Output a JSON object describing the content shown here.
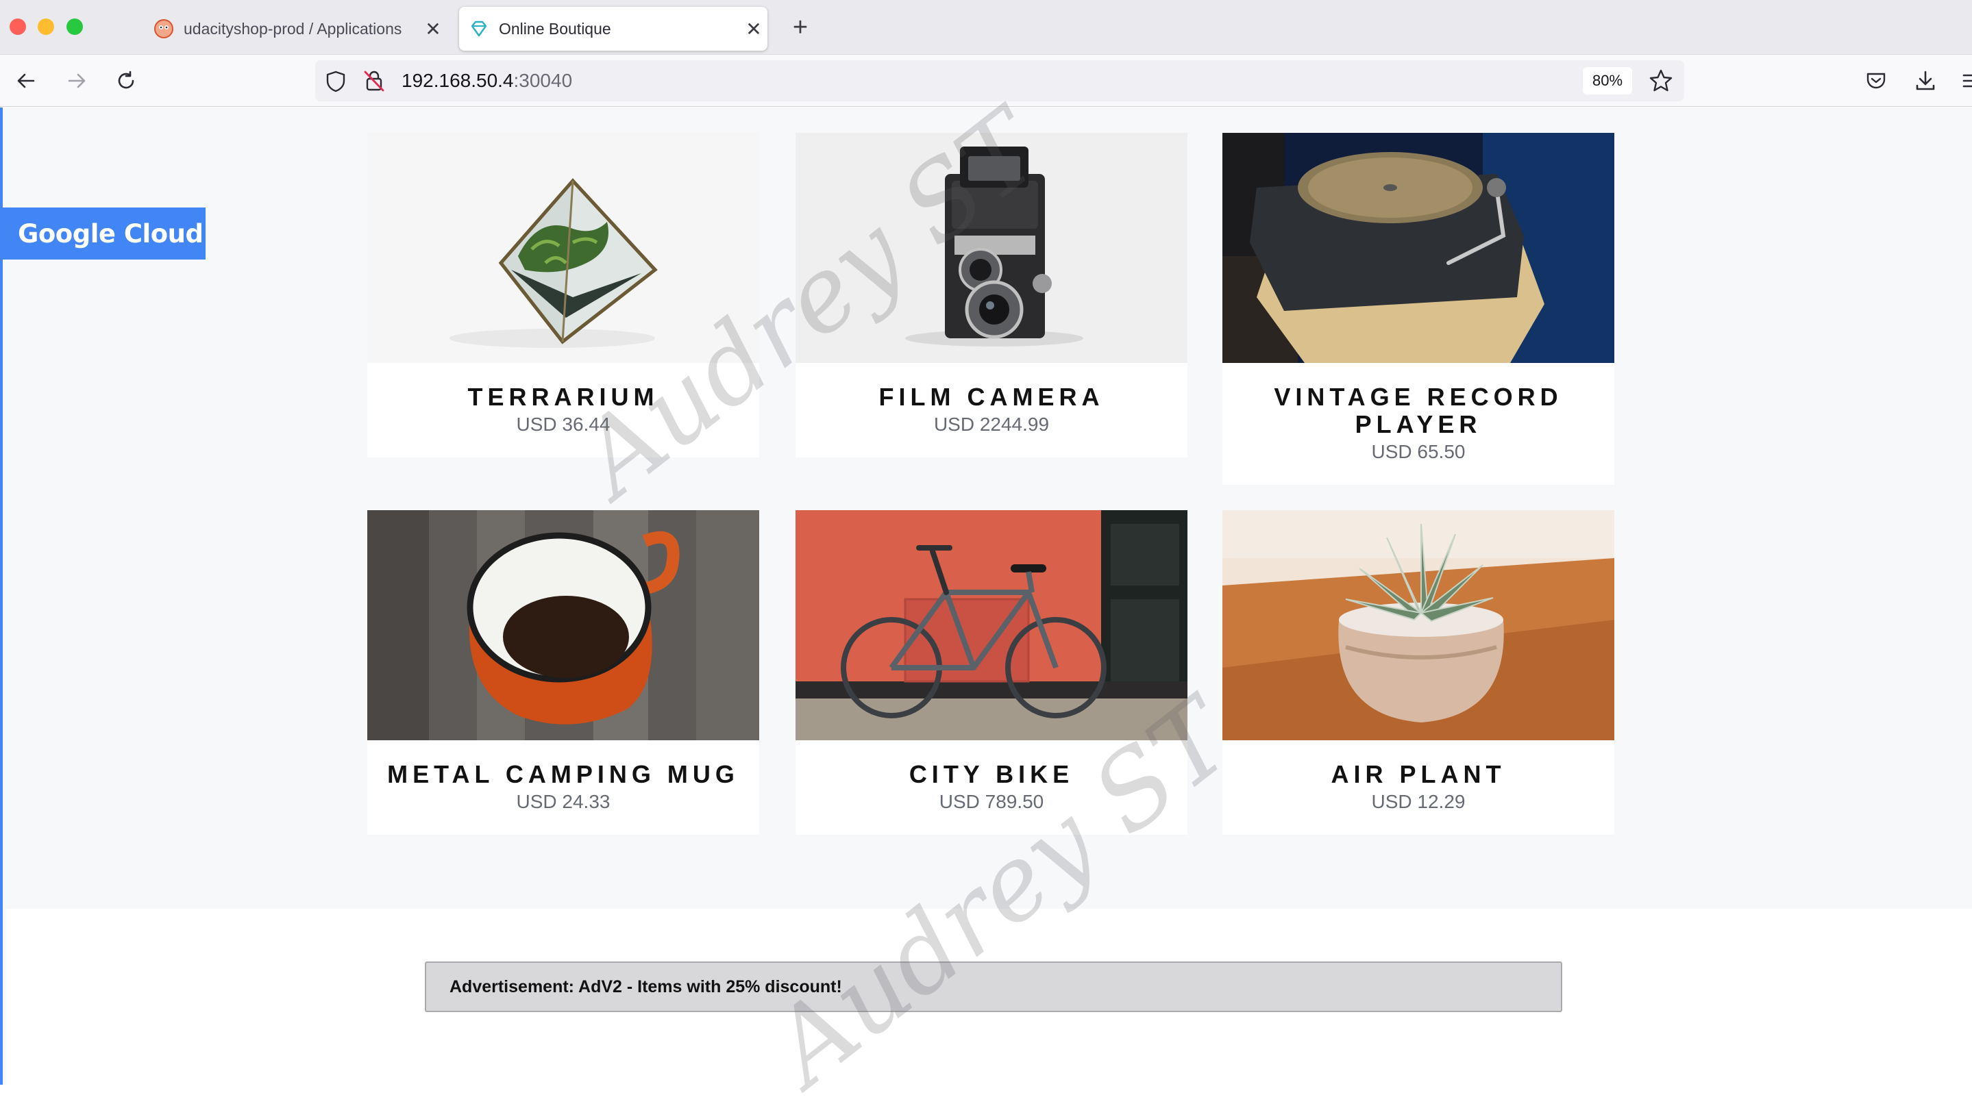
{
  "browser": {
    "tabs": [
      {
        "title": "udacityshop-prod / Applications",
        "active": false
      },
      {
        "title": "Online Boutique",
        "active": true
      }
    ],
    "url_host": "192.168.50.4",
    "url_port": ":30040",
    "zoom": "80%"
  },
  "page": {
    "badge": "Google Cloud",
    "products": [
      {
        "name": "TERRARIUM",
        "price": "USD 36.44",
        "image": "terrarium"
      },
      {
        "name": "FILM CAMERA",
        "price": "USD 2244.99",
        "image": "film-camera"
      },
      {
        "name": "VINTAGE RECORD PLAYER",
        "price": "USD 65.50",
        "image": "record-player"
      },
      {
        "name": "METAL CAMPING MUG",
        "price": "USD 24.33",
        "image": "camping-mug"
      },
      {
        "name": "CITY BIKE",
        "price": "USD 789.50",
        "image": "city-bike"
      },
      {
        "name": "AIR PLANT",
        "price": "USD 12.29",
        "image": "air-plant"
      }
    ],
    "advertisement": "Advertisement: AdV2 - Items with 25% discount!",
    "watermark": "Audrey ST"
  },
  "colors": {
    "accent": "#4285f4",
    "page_bg": "#f7f8fa",
    "ad_bg": "#d8d8db"
  }
}
